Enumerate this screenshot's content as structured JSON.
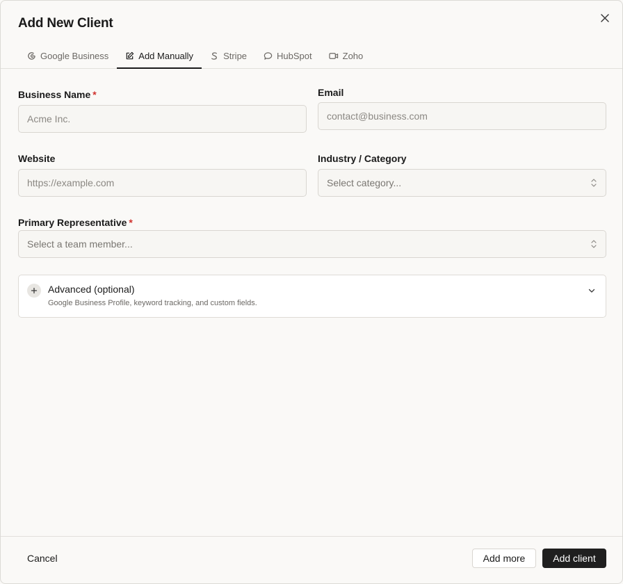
{
  "dialog": {
    "title": "Add New Client",
    "close_icon": "close-icon"
  },
  "tabs": [
    {
      "label": "Google Business",
      "icon": "google-icon",
      "active": false
    },
    {
      "label": "Add Manually",
      "icon": "edit-icon",
      "active": true
    },
    {
      "label": "Stripe",
      "icon": "stripe-icon",
      "active": false
    },
    {
      "label": "HubSpot",
      "icon": "chat-bubble-icon",
      "active": false
    },
    {
      "label": "Zoho",
      "icon": "video-icon",
      "active": false
    }
  ],
  "form": {
    "business_name": {
      "label": "Business Name",
      "required_mark": "*",
      "placeholder": "Acme Inc.",
      "value": ""
    },
    "email": {
      "label": "Email",
      "placeholder": "contact@business.com",
      "value": ""
    },
    "website": {
      "label": "Website",
      "placeholder": "https://example.com",
      "value": ""
    },
    "industry": {
      "label": "Industry / Category",
      "selected": "Select category..."
    },
    "primary_rep": {
      "label": "Primary Representative",
      "required_mark": "*",
      "selected": "Select a team member..."
    }
  },
  "advanced": {
    "title": "Advanced (optional)",
    "description": "Google Business Profile, keyword tracking, and custom fields."
  },
  "footer": {
    "cancel_label": "Cancel",
    "add_more_label": "Add more",
    "add_client_label": "Add client"
  },
  "colors": {
    "accent": "#1f1f1f",
    "required": "#d0322e",
    "background": "#faf9f7"
  }
}
